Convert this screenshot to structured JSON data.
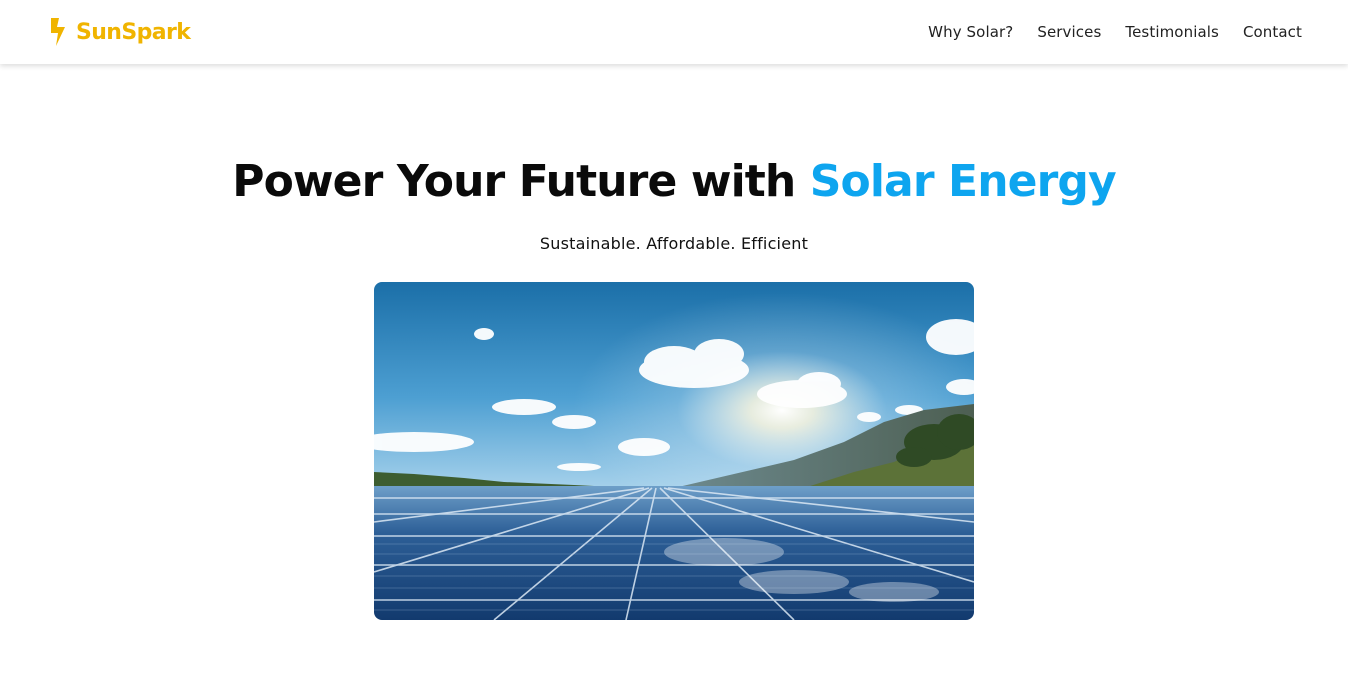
{
  "brand": {
    "name": "SunSpark",
    "color": "#f0b400",
    "icon": "lightning-bolt-icon"
  },
  "nav": {
    "links": [
      {
        "label": "Why Solar?"
      },
      {
        "label": "Services"
      },
      {
        "label": "Testimonials"
      },
      {
        "label": "Contact"
      }
    ]
  },
  "hero": {
    "title_main": "Power Your Future with ",
    "title_accent": "Solar Energy",
    "accent_color": "#0ea5ef",
    "subtitle": "Sustainable. Affordable. Efficient",
    "image": {
      "subject": "solar panels under a blue sky with clouds and mountains"
    }
  }
}
